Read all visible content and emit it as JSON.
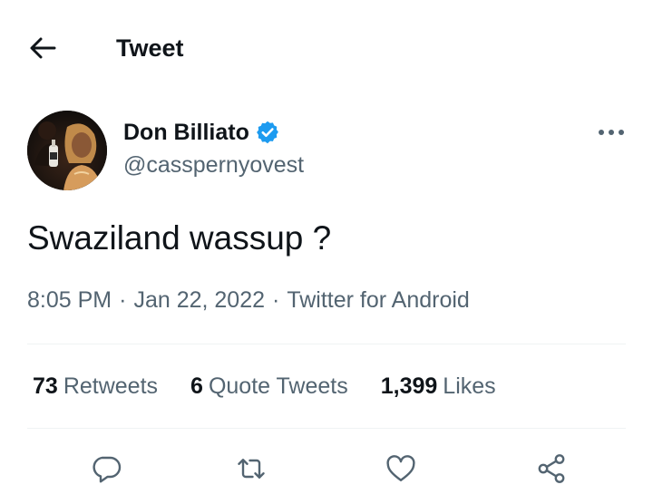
{
  "header": {
    "back_icon": "arrow-left-icon",
    "title": "Tweet"
  },
  "author": {
    "display_name": "Don Billiato",
    "verified_icon": "verified-badge-icon",
    "handle": "@casspernyovest",
    "avatar_icon": "profile-avatar"
  },
  "more_icon": "more-horizontal-icon",
  "tweet": {
    "text": "Swaziland wassup ?",
    "time": "8:05 PM",
    "separator": "·",
    "date": "Jan 22, 2022",
    "source": "Twitter for Android"
  },
  "stats": {
    "retweets": {
      "count": "73",
      "label": "Retweets"
    },
    "quotes": {
      "count": "6",
      "label": "Quote Tweets"
    },
    "likes": {
      "count": "1,399",
      "label": "Likes"
    }
  },
  "actions": {
    "reply_icon": "reply-icon",
    "retweet_icon": "retweet-icon",
    "like_icon": "heart-icon",
    "share_icon": "share-icon"
  },
  "colors": {
    "text_primary": "#0f1419",
    "text_secondary": "#536471",
    "verified": "#1d9bf0",
    "divider": "#eff3f4"
  }
}
